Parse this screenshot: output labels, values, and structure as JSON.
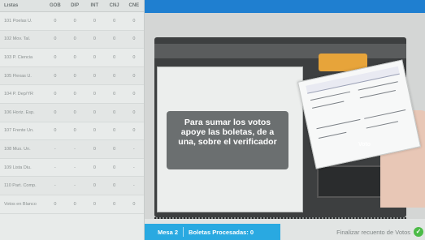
{
  "table": {
    "headers": [
      "Listas",
      "GOB",
      "DIP",
      "INT",
      "CNJ",
      "CNE"
    ],
    "rows": [
      {
        "name": "101 Poelas U.",
        "values": [
          "0",
          "0",
          "0",
          "0",
          "0"
        ]
      },
      {
        "name": "102 Mov. Tal.",
        "values": [
          "0",
          "0",
          "0",
          "0",
          "0"
        ]
      },
      {
        "name": "103 P. Ciencia",
        "values": [
          "0",
          "0",
          "0",
          "0",
          "0"
        ]
      },
      {
        "name": "105 Flexas U.",
        "values": [
          "0",
          "0",
          "0",
          "0",
          "0"
        ]
      },
      {
        "name": "104 P. Dep/YR",
        "values": [
          "0",
          "0",
          "0",
          "0",
          "0"
        ]
      },
      {
        "name": "106 Horiz. Esp.",
        "values": [
          "0",
          "0",
          "0",
          "0",
          "0"
        ]
      },
      {
        "name": "107 Frente Un.",
        "values": [
          "0",
          "0",
          "0",
          "0",
          "0"
        ]
      },
      {
        "name": "108 Mus. Un.",
        "values": [
          "-",
          "-",
          "0",
          "0",
          "-"
        ]
      },
      {
        "name": "109 Lista Diu.",
        "values": [
          "-",
          "-",
          "0",
          "0",
          "-"
        ]
      },
      {
        "name": "110 Part. Comp.",
        "values": [
          "-",
          "-",
          "0",
          "0",
          "-"
        ]
      },
      {
        "name": "Votos en Blanco",
        "values": [
          "0",
          "0",
          "0",
          "0",
          "0"
        ]
      }
    ]
  },
  "tooltip": {
    "line1": "Para sumar los votos",
    "line2": "apoye las boletas, de a",
    "line3": "una, sobre el verificador"
  },
  "ballot_overlay": "Voto",
  "status": {
    "mesa": "Mesa 2",
    "processed": "Boletas Procesadas: 0",
    "finalize": "Finalizar recuento de Votos",
    "check_glyph": "✓"
  },
  "icons": {
    "finalize": "check-circle-icon"
  },
  "colors": {
    "top_bar": "#1f7fd0",
    "mesa_box": "#29a9e1",
    "check": "#4cbb47"
  }
}
